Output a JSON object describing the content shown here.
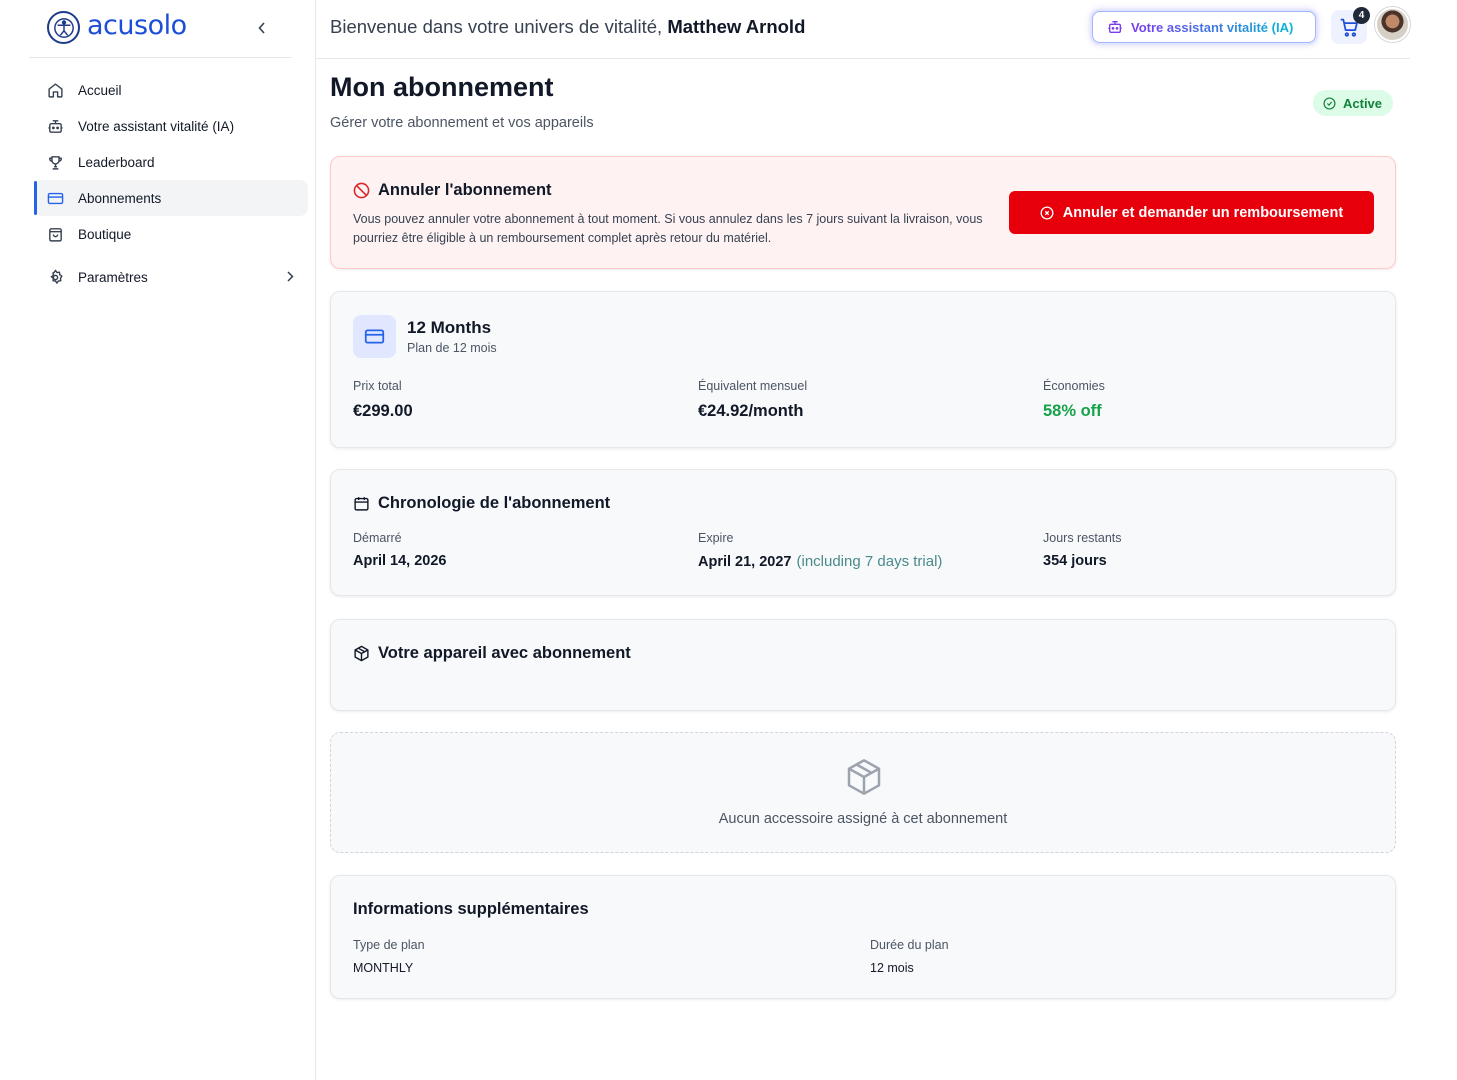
{
  "brand": {
    "name": "acusolo"
  },
  "sidebar": {
    "items": [
      {
        "label": "Accueil",
        "icon": "home-icon"
      },
      {
        "label": "Votre assistant vitalité (IA)",
        "icon": "robot-icon"
      },
      {
        "label": "Leaderboard",
        "icon": "trophy-icon"
      },
      {
        "label": "Abonnements",
        "icon": "credit-card-icon",
        "active": true
      },
      {
        "label": "Boutique",
        "icon": "shopping-bag-icon"
      },
      {
        "label": "Paramètres",
        "icon": "gear-icon"
      }
    ]
  },
  "header": {
    "welcome_prefix": "Bienvenue dans votre univers de vitalité,",
    "user_name": "Matthew Arnold",
    "ai_button_label": "Votre assistant vitalité (IA)",
    "cart_count": "4"
  },
  "page": {
    "title": "Mon abonnement",
    "subtitle": "Gérer votre abonnement et vos appareils",
    "status": "Active"
  },
  "cancel": {
    "title": "Annuler l'abonnement",
    "text": "Vous pouvez annuler votre abonnement à tout moment. Si vous annulez dans les 7 jours suivant la livraison, vous pourriez être éligible à un remboursement complet après retour du matériel.",
    "button_label": "Annuler et demander un remboursement"
  },
  "plan": {
    "name": "12 Months",
    "subtitle": "Plan de 12 mois",
    "total_price_label": "Prix total",
    "total_price": "€299.00",
    "monthly_label": "Équivalent mensuel",
    "monthly": "€24.92/month",
    "savings_label": "Économies",
    "savings": "58% off"
  },
  "timeline": {
    "title": "Chronologie de l'abonnement",
    "started_label": "Démarré",
    "started": "April 14, 2026",
    "expires_label": "Expire",
    "expires": "April 21, 2027",
    "expires_note": "(including 7 days trial)",
    "remaining_label": "Jours restants",
    "remaining": "354 jours"
  },
  "device": {
    "title": "Votre appareil avec abonnement",
    "empty_text": "Aucun accessoire assigné à cet abonnement"
  },
  "info": {
    "title": "Informations supplémentaires",
    "plan_type_label": "Type de plan",
    "plan_type": "MONTHLY",
    "duration_label": "Durée du plan",
    "duration": "12 mois"
  },
  "colors": {
    "accent": "#2563eb",
    "danger": "#e7000b",
    "success": "#16a34a"
  }
}
